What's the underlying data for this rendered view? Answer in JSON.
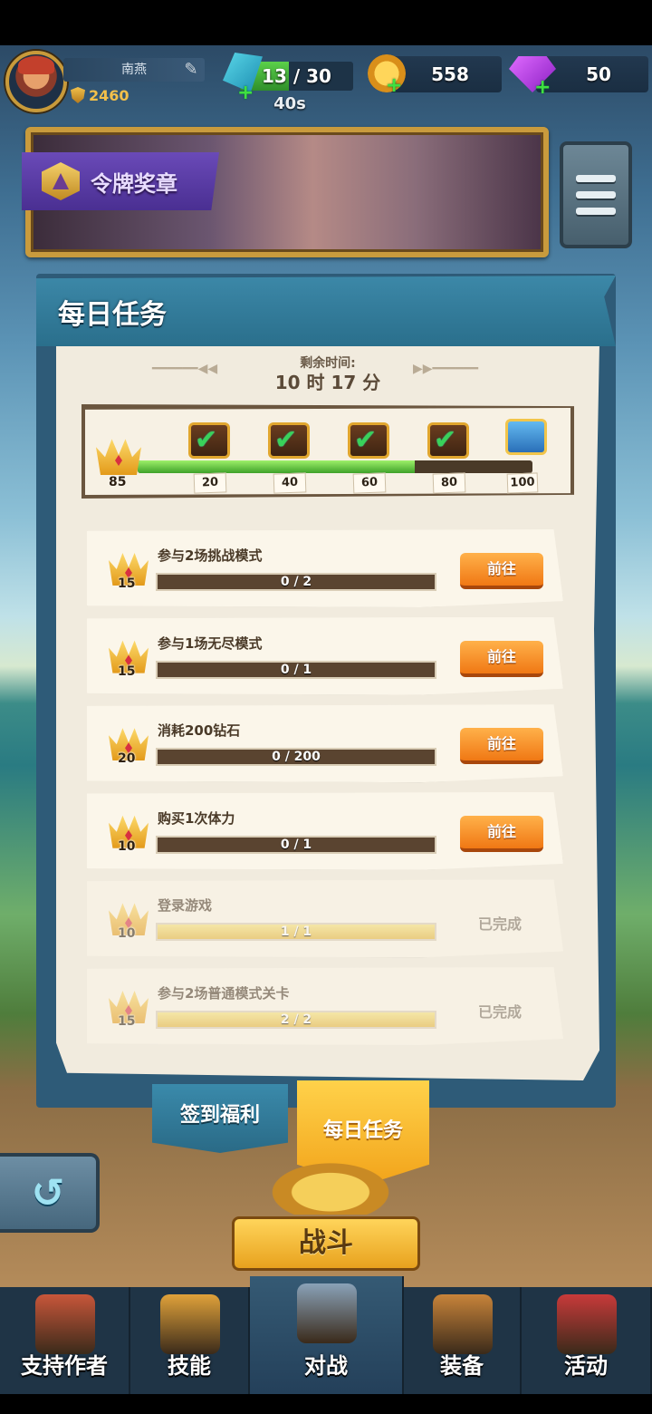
{
  "player": {
    "name": "南燕",
    "score": "2460"
  },
  "resources": {
    "energy": {
      "text": "13 / 30",
      "current": 13,
      "max": 30,
      "timer": "40s"
    },
    "coins": "558",
    "gems": "50"
  },
  "banner": {
    "label": "令牌奖章"
  },
  "panel": {
    "title": "每日任务",
    "remaining_title": "剩余时间:",
    "remaining_time": "10 时 17 分"
  },
  "progress": {
    "current": "85",
    "current_value": 85,
    "milestones": [
      {
        "label": "20",
        "value": 20,
        "claimed": true
      },
      {
        "label": "40",
        "value": 40,
        "claimed": true
      },
      {
        "label": "60",
        "value": 60,
        "claimed": true
      },
      {
        "label": "80",
        "value": 80,
        "claimed": true
      },
      {
        "label": "100",
        "value": 100,
        "claimed": false
      }
    ]
  },
  "tasks": [
    {
      "title": "参与2场挑战模式",
      "reward": "15",
      "progress_text": "0 / 2",
      "progress": 0,
      "action": "前往",
      "done": false
    },
    {
      "title": "参与1场无尽模式",
      "reward": "15",
      "progress_text": "0 / 1",
      "progress": 0,
      "action": "前往",
      "done": false
    },
    {
      "title": "消耗200钻石",
      "reward": "20",
      "progress_text": "0 / 200",
      "progress": 0,
      "action": "前往",
      "done": false
    },
    {
      "title": "购买1次体力",
      "reward": "10",
      "progress_text": "0 / 1",
      "progress": 0,
      "action": "前往",
      "done": false
    },
    {
      "title": "登录游戏",
      "reward": "10",
      "progress_text": "1 / 1",
      "progress": 1,
      "action": "已完成",
      "done": true
    },
    {
      "title": "参与2场普通模式关卡",
      "reward": "15",
      "progress_text": "2 / 2",
      "progress": 1,
      "action": "已完成",
      "done": true
    }
  ],
  "tabs": {
    "checkin": "签到福利",
    "daily": "每日任务"
  },
  "battle_button": "战斗",
  "nav": [
    {
      "label": "支持作者",
      "icon": "shop-icon"
    },
    {
      "label": "技能",
      "icon": "skill-icon"
    },
    {
      "label": "对战",
      "icon": "battle-icon"
    },
    {
      "label": "装备",
      "icon": "equipment-icon"
    },
    {
      "label": "活动",
      "icon": "event-icon"
    }
  ],
  "colors": {
    "accent_orange": "#f07814",
    "bar_green": "#3fa22a",
    "panel_blue": "#2a6f8c",
    "gold": "#e39a1a"
  }
}
